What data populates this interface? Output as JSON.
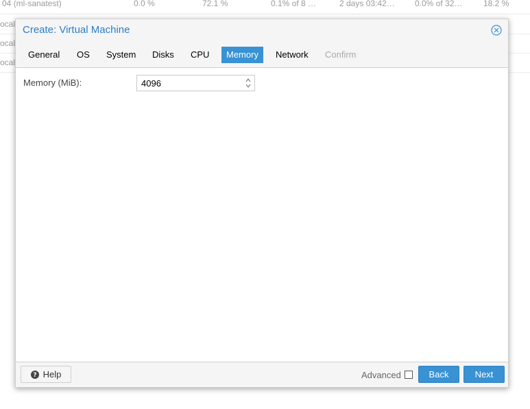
{
  "background_table": {
    "rows": [
      [
        "04 (ml-sanatest)",
        "0.0 %",
        "72.1 %",
        "0.1% of 8 …",
        "2 days 03:42…",
        "0.0% of 32…",
        "18.2 %"
      ],
      [
        "ocal",
        "",
        "",
        "",
        "",
        "",
        ""
      ],
      [
        "ocal",
        "",
        "",
        "",
        "",
        "",
        ""
      ],
      [
        "ocal",
        "",
        "",
        "",
        "",
        "",
        ""
      ]
    ]
  },
  "dialog": {
    "title": "Create: Virtual Machine",
    "close_icon": "close-circle-icon",
    "tabs": [
      {
        "label": "General",
        "state": "normal"
      },
      {
        "label": "OS",
        "state": "normal"
      },
      {
        "label": "System",
        "state": "normal"
      },
      {
        "label": "Disks",
        "state": "normal"
      },
      {
        "label": "CPU",
        "state": "normal"
      },
      {
        "label": "Memory",
        "state": "active"
      },
      {
        "label": "Network",
        "state": "normal"
      },
      {
        "label": "Confirm",
        "state": "disabled"
      }
    ],
    "memory_field": {
      "label": "Memory (MiB):",
      "value": "4096"
    },
    "footer": {
      "help_label": "Help",
      "help_icon": "question-circle-icon",
      "advanced_label": "Advanced",
      "advanced_checked": false,
      "back_label": "Back",
      "next_label": "Next"
    }
  },
  "colors": {
    "accent": "#3892d4",
    "title": "#2b7ec9",
    "disabled_text": "#a8a8a8"
  }
}
